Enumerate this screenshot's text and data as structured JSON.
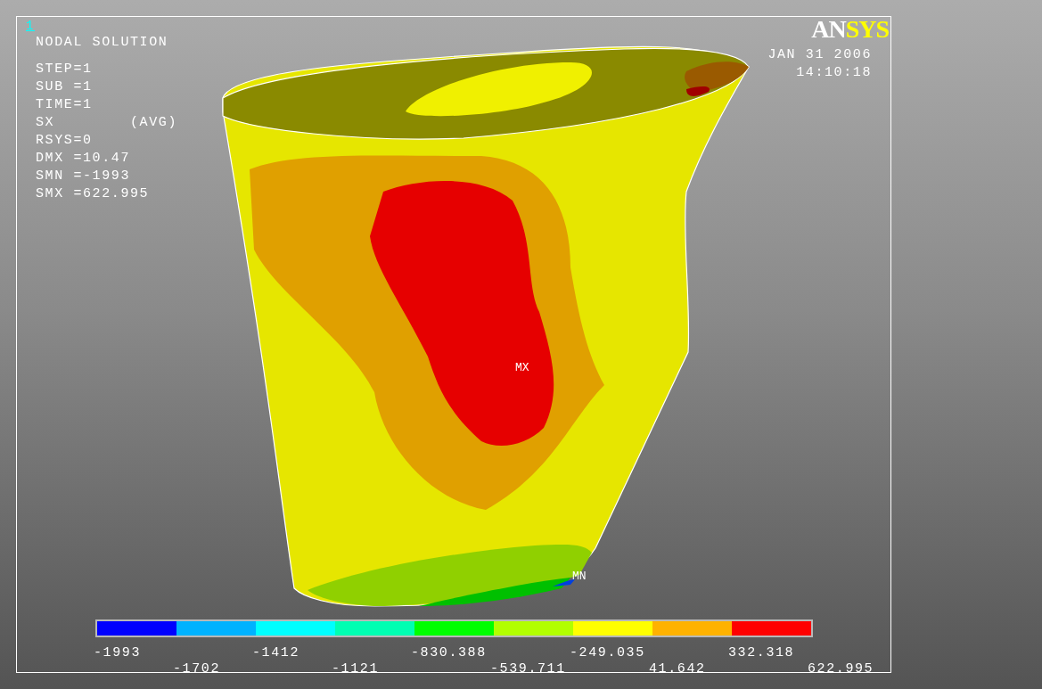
{
  "window_number": "1",
  "title": "NODAL SOLUTION",
  "info_lines": [
    "STEP=1",
    "SUB =1",
    "TIME=1",
    "SX        (AVG)",
    "RSYS=0",
    "DMX =10.47",
    "SMN =-1993",
    "SMX =622.995"
  ],
  "logo": [
    {
      "text": "AN",
      "color": "#ffffff"
    },
    {
      "text": "SYS",
      "color": "#ffff00"
    }
  ],
  "date": "JAN 31 2006",
  "time": "14:10:18",
  "markers": [
    {
      "kind": "max",
      "label": "MX"
    },
    {
      "kind": "min",
      "label": "MN"
    }
  ],
  "legend": {
    "bins": [
      {
        "color": "#0000ff"
      },
      {
        "color": "#00b2ff"
      },
      {
        "color": "#00ffff"
      },
      {
        "color": "#00ffb2"
      },
      {
        "color": "#00ff00"
      },
      {
        "color": "#b2ff00"
      },
      {
        "color": "#ffff00"
      },
      {
        "color": "#ffb200"
      },
      {
        "color": "#ff0000"
      }
    ],
    "labels": [
      "-1993",
      "-1702",
      "-1412",
      "-1121",
      "-830.388",
      "-539.711",
      "-249.035",
      "41.642",
      "332.318",
      "622.995"
    ]
  }
}
